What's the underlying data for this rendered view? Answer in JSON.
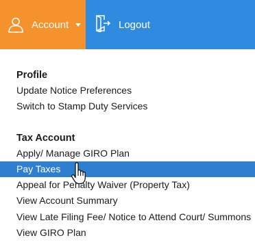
{
  "topbar": {
    "account": {
      "icon": "user-icon",
      "label": "Account",
      "caret": "chevron-down-icon",
      "bg_color": "#f5922b"
    },
    "logout": {
      "icon": "logout-door-icon",
      "label": "Logout",
      "bg_color": "#2f8be0"
    }
  },
  "menu": {
    "profile": {
      "heading": "Profile",
      "items": [
        {
          "label": "Update Notice Preferences"
        },
        {
          "label": "Switch to Stamp Duty Services"
        }
      ]
    },
    "tax_account": {
      "heading": "Tax Account",
      "items": [
        {
          "label": "Apply/ Manage GIRO Plan"
        },
        {
          "label": "Pay Taxes",
          "active": true
        },
        {
          "label": "Appeal for Penalty Waiver (Property Tax)"
        },
        {
          "label": "View Account Summary"
        },
        {
          "label": "View Late Filing Fee/ Notice to Attend Court/ Summons"
        },
        {
          "label": "View GIRO Plan"
        }
      ]
    },
    "highlight_color": "#2f7fd1"
  },
  "cursor": {
    "icon": "hand-pointer-icon"
  }
}
